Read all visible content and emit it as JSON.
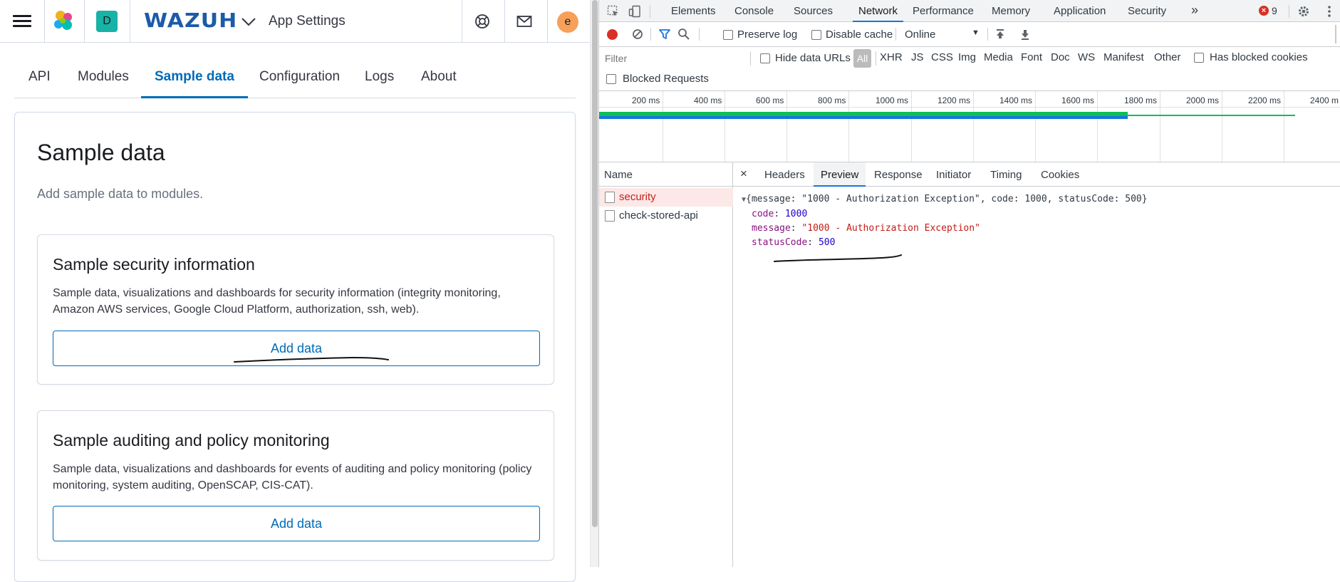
{
  "app": {
    "space_initial": "D",
    "logo_text": "WAZUH",
    "title": "App Settings",
    "user_initial": "e",
    "tabs": [
      "API",
      "Modules",
      "Sample data",
      "Configuration",
      "Logs",
      "About"
    ],
    "active_tab": "Sample data",
    "panel": {
      "title": "Sample data",
      "description": "Add sample data to modules.",
      "cards": [
        {
          "title": "Sample security information",
          "description": "Sample data, visualizations and dashboards for security information (integrity monitoring, Amazon AWS services, Google Cloud Platform, authorization, ssh, web).",
          "button": "Add data"
        },
        {
          "title": "Sample auditing and policy monitoring",
          "description": "Sample data, visualizations and dashboards for events of auditing and policy monitoring (policy monitoring, system auditing, OpenSCAP, CIS-CAT).",
          "button": "Add data"
        }
      ]
    },
    "icons": [
      "menu-icon",
      "elastic-logo",
      "chevron-down-icon",
      "help-icon",
      "mail-icon"
    ]
  },
  "devtools": {
    "tabs": [
      "Elements",
      "Console",
      "Sources",
      "Network",
      "Performance",
      "Memory",
      "Application",
      "Security"
    ],
    "active_tab": "Network",
    "more_tabs": "»",
    "error_count": "9",
    "toolbar": {
      "preserve_log": "Preserve log",
      "disable_cache": "Disable cache",
      "throttling": "Online"
    },
    "filter": {
      "placeholder": "Filter",
      "hide_data_urls": "Hide data URLs",
      "types": [
        "All",
        "XHR",
        "JS",
        "CSS",
        "Img",
        "Media",
        "Font",
        "Doc",
        "WS",
        "Manifest",
        "Other"
      ],
      "has_blocked_cookies": "Has blocked cookies",
      "blocked_requests": "Blocked Requests"
    },
    "timeline_ticks": [
      "200 ms",
      "400 ms",
      "600 ms",
      "800 ms",
      "1000 ms",
      "1200 ms",
      "1400 ms",
      "1600 ms",
      "1800 ms",
      "2000 ms",
      "2200 ms",
      "2400 m"
    ],
    "requests_header": "Name",
    "requests": [
      {
        "name": "security",
        "status": "error"
      },
      {
        "name": "check-stored-api",
        "status": "ok"
      }
    ],
    "detail_close": "×",
    "detail_tabs": [
      "Headers",
      "Preview",
      "Response",
      "Initiator",
      "Timing",
      "Cookies"
    ],
    "active_detail_tab": "Preview",
    "preview": {
      "summary": "{message: \"1000 - Authorization Exception\", code: 1000, statusCode: 500}",
      "code_key": "code",
      "code_value": "1000",
      "message_key": "message",
      "message_value": "\"1000 - Authorization Exception\"",
      "status_key": "statusCode",
      "status_value": "500"
    },
    "colors": {
      "accent": "#1a73e8",
      "error_text": "#c5221f",
      "bar_blue": "#1a73e8",
      "bar_green": "#0cbf56"
    }
  }
}
